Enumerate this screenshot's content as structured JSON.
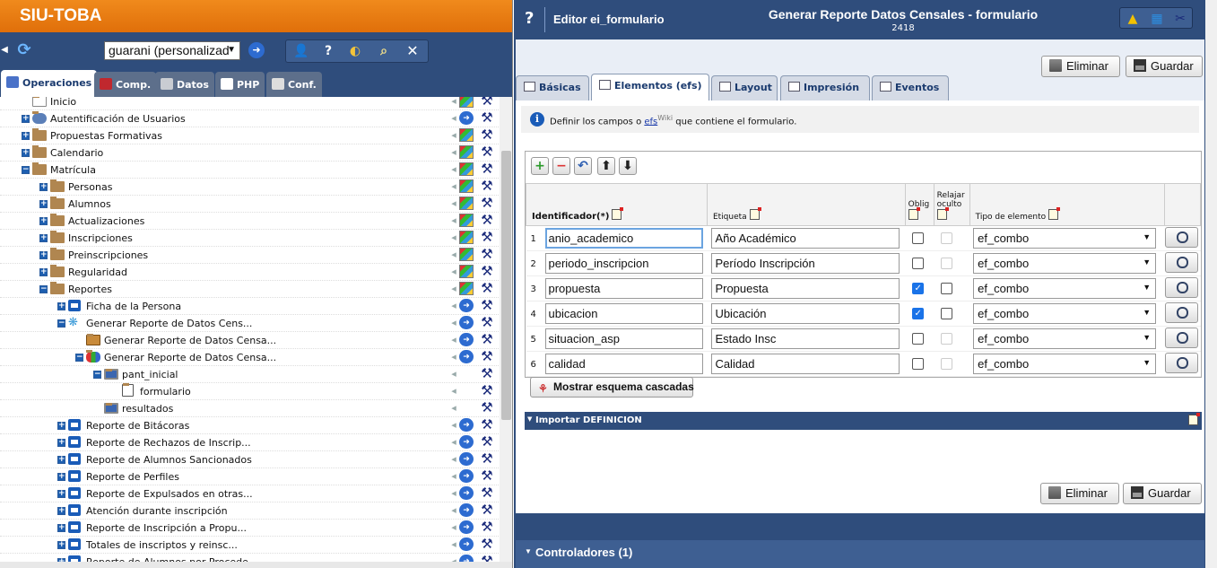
{
  "app": {
    "brand": "SIU-TOBA",
    "project": "guarani (personalizad"
  },
  "left_tabs": [
    {
      "label": "Operaciones",
      "color": "#4a72c8"
    },
    {
      "label": "Comp.",
      "color": "#c0282e"
    },
    {
      "label": "Datos",
      "color": "#9aa0aa"
    },
    {
      "label": "PHP",
      "color": "#7c7c9c"
    },
    {
      "label": "Conf.",
      "color": "#a0a0a0"
    }
  ],
  "tree": [
    {
      "label": "Inicio",
      "depth": 0,
      "toggle": "",
      "icon": "none",
      "act": "m"
    },
    {
      "label": "Autentificación de Usuarios",
      "depth": 0,
      "toggle": "+",
      "icon": "user",
      "act": "c"
    },
    {
      "label": "Propuestas Formativas",
      "depth": 0,
      "toggle": "+",
      "icon": "folder",
      "act": "m"
    },
    {
      "label": "Calendario",
      "depth": 0,
      "toggle": "+",
      "icon": "folder",
      "act": "m"
    },
    {
      "label": "Matrícula",
      "depth": 0,
      "toggle": "-",
      "icon": "folder",
      "act": "m"
    },
    {
      "label": "Personas",
      "depth": 1,
      "toggle": "+",
      "icon": "folder",
      "act": "m"
    },
    {
      "label": "Alumnos",
      "depth": 1,
      "toggle": "+",
      "icon": "folder",
      "act": "m"
    },
    {
      "label": "Actualizaciones",
      "depth": 1,
      "toggle": "+",
      "icon": "folder",
      "act": "m"
    },
    {
      "label": "Inscripciones",
      "depth": 1,
      "toggle": "+",
      "icon": "folder",
      "act": "m"
    },
    {
      "label": "Preinscripciones",
      "depth": 1,
      "toggle": "+",
      "icon": "folder",
      "act": "m"
    },
    {
      "label": "Regularidad",
      "depth": 1,
      "toggle": "+",
      "icon": "folder",
      "act": "m"
    },
    {
      "label": "Reportes",
      "depth": 1,
      "toggle": "-",
      "icon": "folder",
      "act": "m"
    },
    {
      "label": "Ficha de la Persona",
      "depth": 2,
      "toggle": "+",
      "icon": "print",
      "act": "c"
    },
    {
      "label": "Generar Reporte de Datos Cens...",
      "depth": 2,
      "toggle": "-",
      "icon": "gear",
      "act": "c"
    },
    {
      "label": "Generar Reporte de Datos Censa...",
      "depth": 3,
      "toggle": "",
      "icon": "bag",
      "act": "c"
    },
    {
      "label": "Generar Reporte de Datos Censa...",
      "depth": 3,
      "toggle": "-",
      "icon": "blocks",
      "act": "c"
    },
    {
      "label": "pant_inicial",
      "depth": 4,
      "toggle": "-",
      "icon": "monitor",
      "act": "h"
    },
    {
      "label": "formulario",
      "depth": 5,
      "toggle": "",
      "icon": "form",
      "act": "h"
    },
    {
      "label": "resultados",
      "depth": 4,
      "toggle": "",
      "icon": "monitor",
      "act": "h"
    },
    {
      "label": "Reporte de Bitácoras",
      "depth": 2,
      "toggle": "+",
      "icon": "print",
      "act": "c"
    },
    {
      "label": "Reporte de Rechazos de Inscrip...",
      "depth": 2,
      "toggle": "+",
      "icon": "print",
      "act": "c"
    },
    {
      "label": "Reporte de Alumnos Sancionados",
      "depth": 2,
      "toggle": "+",
      "icon": "print",
      "act": "c"
    },
    {
      "label": "Reporte de Perfiles",
      "depth": 2,
      "toggle": "+",
      "icon": "print",
      "act": "c"
    },
    {
      "label": "Reporte de Expulsados en otras...",
      "depth": 2,
      "toggle": "+",
      "icon": "print",
      "act": "c"
    },
    {
      "label": "Atención durante inscripción",
      "depth": 2,
      "toggle": "+",
      "icon": "print",
      "act": "c"
    },
    {
      "label": "Reporte de Inscripción a Propu...",
      "depth": 2,
      "toggle": "+",
      "icon": "print",
      "act": "c"
    },
    {
      "label": "Totales de inscriptos y reinsc...",
      "depth": 2,
      "toggle": "+",
      "icon": "print",
      "act": "c"
    },
    {
      "label": "Reporte de Alumnos por Procede...",
      "depth": 2,
      "toggle": "+",
      "icon": "print",
      "act": "c"
    }
  ],
  "editor": {
    "help": "?",
    "label": "Editor ei_formulario",
    "title": "Generar Reporte Datos Censales - formulario",
    "id": "2418",
    "delete_label": "Eliminar",
    "save_label": "Guardar"
  },
  "right_tabs": [
    {
      "label": "Básicas"
    },
    {
      "label": "Elementos (efs)"
    },
    {
      "label": "Layout"
    },
    {
      "label": "Impresión"
    },
    {
      "label": "Eventos"
    }
  ],
  "info": {
    "pre": "Definir los campos o ",
    "link": "efs",
    "sup": "Wiki",
    "post": " que contiene el formulario."
  },
  "grid": {
    "headers": {
      "id": "Identificador(*)",
      "label": "Etiqueta",
      "oblig": "Oblig",
      "relajar": "Relajar oculto",
      "tipo": "Tipo de elemento"
    },
    "rows": [
      {
        "n": "1",
        "id": "anio_academico",
        "label": "Año Académico",
        "oblig": false,
        "relajar": false,
        "relajar_enabled": false,
        "tipo": "ef_combo"
      },
      {
        "n": "2",
        "id": "periodo_inscripcion",
        "label": "Período Inscripción",
        "oblig": false,
        "relajar": false,
        "relajar_enabled": false,
        "tipo": "ef_combo"
      },
      {
        "n": "3",
        "id": "propuesta",
        "label": "Propuesta",
        "oblig": true,
        "relajar": false,
        "relajar_enabled": true,
        "tipo": "ef_combo"
      },
      {
        "n": "4",
        "id": "ubicacion",
        "label": "Ubicación",
        "oblig": true,
        "relajar": false,
        "relajar_enabled": true,
        "tipo": "ef_combo"
      },
      {
        "n": "5",
        "id": "situacion_asp",
        "label": "Estado Insc",
        "oblig": false,
        "relajar": false,
        "relajar_enabled": false,
        "tipo": "ef_combo"
      },
      {
        "n": "6",
        "id": "calidad",
        "label": "Calidad",
        "oblig": false,
        "relajar": false,
        "relajar_enabled": false,
        "tipo": "ef_combo"
      }
    ],
    "cascade_label": "Mostrar esquema cascadas"
  },
  "import_label": "Importar DEFINICION",
  "controladores_label": "Controladores (1)"
}
